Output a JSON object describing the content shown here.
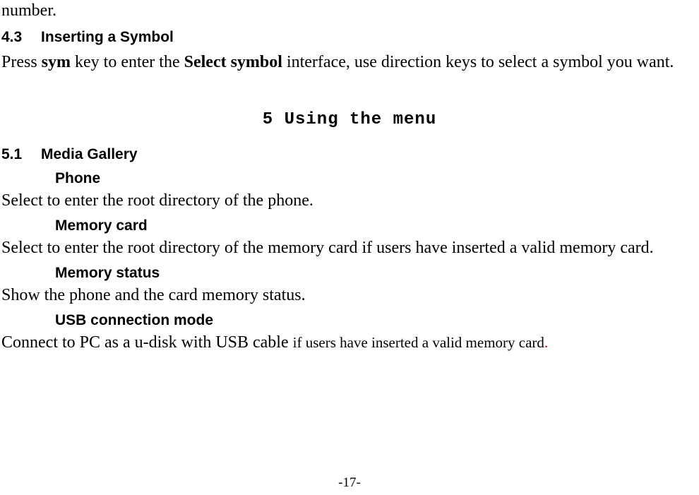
{
  "top_fragment": "number.",
  "sec_4_3": {
    "num": "4.3",
    "title": "Inserting a Symbol"
  },
  "p_4_3": {
    "pre": "Press ",
    "sym": "sym",
    "mid": " key to enter the ",
    "select_symbol": "Select symbol",
    "post": " interface, use direction keys to select a symbol you want."
  },
  "chapter_5": "5  Using the menu",
  "sec_5_1": {
    "num": "5.1",
    "title": "Media Gallery"
  },
  "sub_phone": "Phone",
  "p_phone": "Select to enter the root directory of the phone.",
  "sub_memcard": "Memory card",
  "p_memcard": "Select to enter the root directory of the memory card if users have inserted a valid memory card.",
  "sub_memstatus": "Memory status",
  "p_memstatus": "Show the phone and the card memory status.",
  "sub_usb": "USB connection mode",
  "p_usb": {
    "large": "Connect to PC as a u-disk with USB cable ",
    "small": "if users have inserted a valid memory card",
    "dot": "."
  },
  "page_number": "-17-"
}
